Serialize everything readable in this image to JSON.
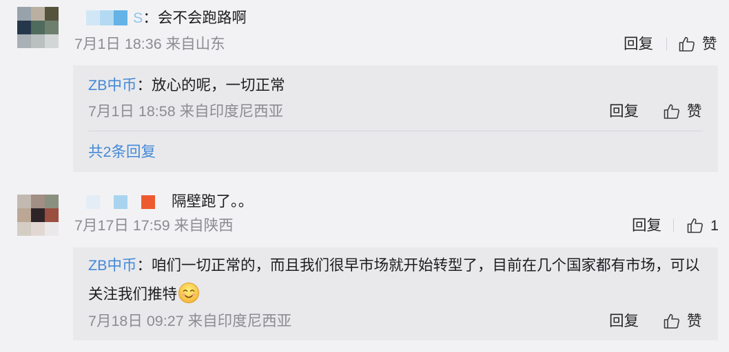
{
  "colors": {
    "page_bg": "#f2f2f5",
    "reply_block_bg": "#e9e9ec",
    "link": "#4389d6",
    "meta": "#8c8c91",
    "text": "#1d1d1f"
  },
  "comments": [
    {
      "avatar_mosaic": [
        "#98a2ab",
        "#bab0a2",
        "#56533d",
        "#25374a",
        "#4f6b5d",
        "#6e7f6d",
        "#a9b1b6",
        "#b9c0bf",
        "#d3d6d6"
      ],
      "username_blocks": [
        "#d2e7f6",
        "#b3daf2",
        "#63b3e6"
      ],
      "username_tail": "S",
      "text": "：会不会跑路啊",
      "meta": "7月1日 18:36 来自山东",
      "reply_label": "回复",
      "like_icon": "thumbs-up-icon",
      "like_label": "赞",
      "replies": [
        {
          "author": "ZB中币",
          "text": "：放心的呢，一切正常",
          "meta": "7月1日 18:58 来自印度尼西亚",
          "reply_label": "回复",
          "like_icon": "thumbs-up-icon",
          "like_label": "赞"
        }
      ],
      "more_replies_label": "共2条回复"
    },
    {
      "avatar_mosaic": [
        "#c2b9b0",
        "#a18e84",
        "#8a9080",
        "#bba794",
        "#2e2427",
        "#9a4f41",
        "#d4cdc4",
        "#e3d7d4",
        "#ebe8e9"
      ],
      "username_blocks": [
        "#e4edf6",
        "#a9d4ef",
        "#ee5a30"
      ],
      "text": "隔壁跑了。。",
      "meta": "7月17日 17:59 来自陕西",
      "reply_label": "回复",
      "like_icon": "thumbs-up-icon",
      "like_count": "1",
      "replies": [
        {
          "author": "ZB中币",
          "text": "：咱们一切正常的，而且我们很早市场就开始转型了，目前在几个国家都有市场，可以关注我们推特",
          "emoji_icon": "smiling-face-icon",
          "meta": "7月18日 09:27 来自印度尼西亚",
          "reply_label": "回复",
          "like_icon": "thumbs-up-icon",
          "like_label": "赞"
        }
      ]
    }
  ]
}
